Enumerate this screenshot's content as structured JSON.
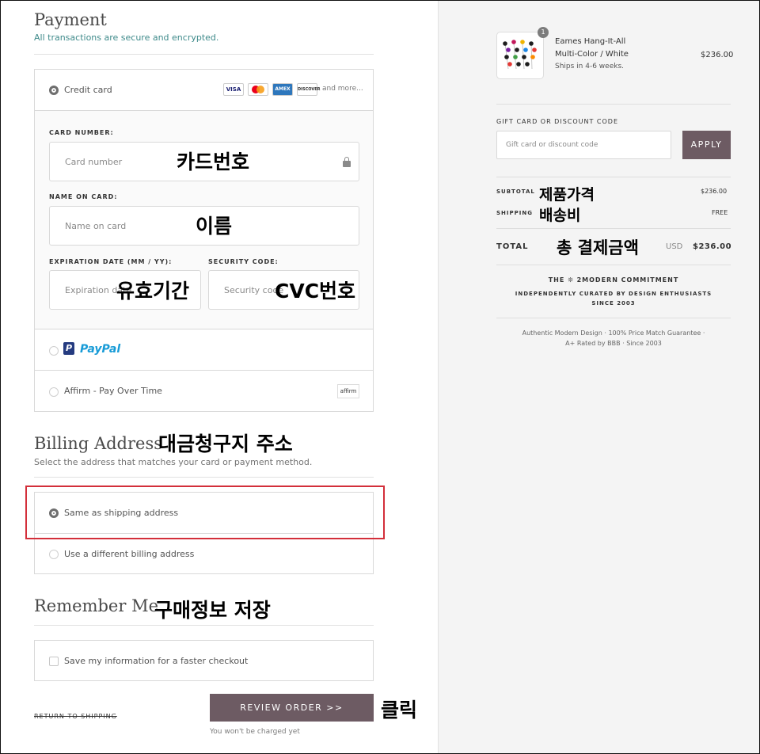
{
  "colors": {
    "accent": "#6d5b63",
    "secure_text": "#3e8a8a",
    "highlight": "#d32f3a",
    "paypal_dark": "#253b80",
    "paypal_light": "#179bd7"
  },
  "payment": {
    "title": "Payment",
    "subtitle": "All transactions are secure and encrypted.",
    "credit_card_label": "Credit card",
    "card_brands": [
      "VISA",
      "Mastercard",
      "AMEX",
      "DISCOVER"
    ],
    "and_more": "and more...",
    "card_number_label": "CARD NUMBER:",
    "card_number_placeholder": "Card number",
    "name_label": "NAME ON CARD:",
    "name_placeholder": "Name on card",
    "expiry_label": "EXPIRATION DATE (MM / YY):",
    "expiry_placeholder": "Expiration date",
    "security_label": "SECURITY CODE:",
    "security_placeholder": "Security code",
    "paypal_label": "PayPal",
    "affirm_label": "Affirm - Pay Over Time",
    "affirm_logo": "affirm"
  },
  "billing": {
    "title": "Billing Address",
    "subtitle": "Select the address that matches your card or payment method.",
    "same_label": "Same as shipping address",
    "different_label": "Use a different billing address"
  },
  "remember": {
    "title": "Remember Me",
    "save_label": "Save my information for a faster checkout"
  },
  "actions": {
    "return_label": "RETURN TO SHIPPING",
    "review_label": "REVIEW ORDER >>",
    "charged_note": "You won't be charged yet"
  },
  "summary": {
    "qty": "1",
    "product_name": "Eames Hang-It-All",
    "product_variant": "Multi-Color / White",
    "product_ship": "Ships in 4-6 weeks.",
    "product_price": "$236.00",
    "gift_label": "GIFT CARD OR DISCOUNT CODE",
    "gift_placeholder": "Gift card or discount code",
    "apply_label": "APPLY",
    "subtotal_label": "SUBTOTAL",
    "subtotal_value": "$236.00",
    "shipping_label": "SHIPPING",
    "shipping_value": "FREE",
    "total_label": "TOTAL",
    "total_currency": "USD",
    "total_value": "$236.00",
    "commitment_title": "THE ❊ 2MODERN COMMITMENT",
    "commitment_line1": "INDEPENDENTLY CURATED BY DESIGN ENTHUSIASTS",
    "commitment_line2": "SINCE 2003",
    "footer_line1": "Authentic Modern Design · 100% Price Match Guarantee ·",
    "footer_line2": "A+ Rated by BBB · Since 2003"
  },
  "annotations": {
    "card_number": "카드번호",
    "name": "이름",
    "expiry": "유효기간",
    "cvc": "CVC번호",
    "billing": "대금청구지 주소",
    "remember": "구매정보 저장",
    "click": "클릭",
    "product_price": "제품가격",
    "shipping_fee": "배송비",
    "total_amount": "총 결제금액"
  }
}
